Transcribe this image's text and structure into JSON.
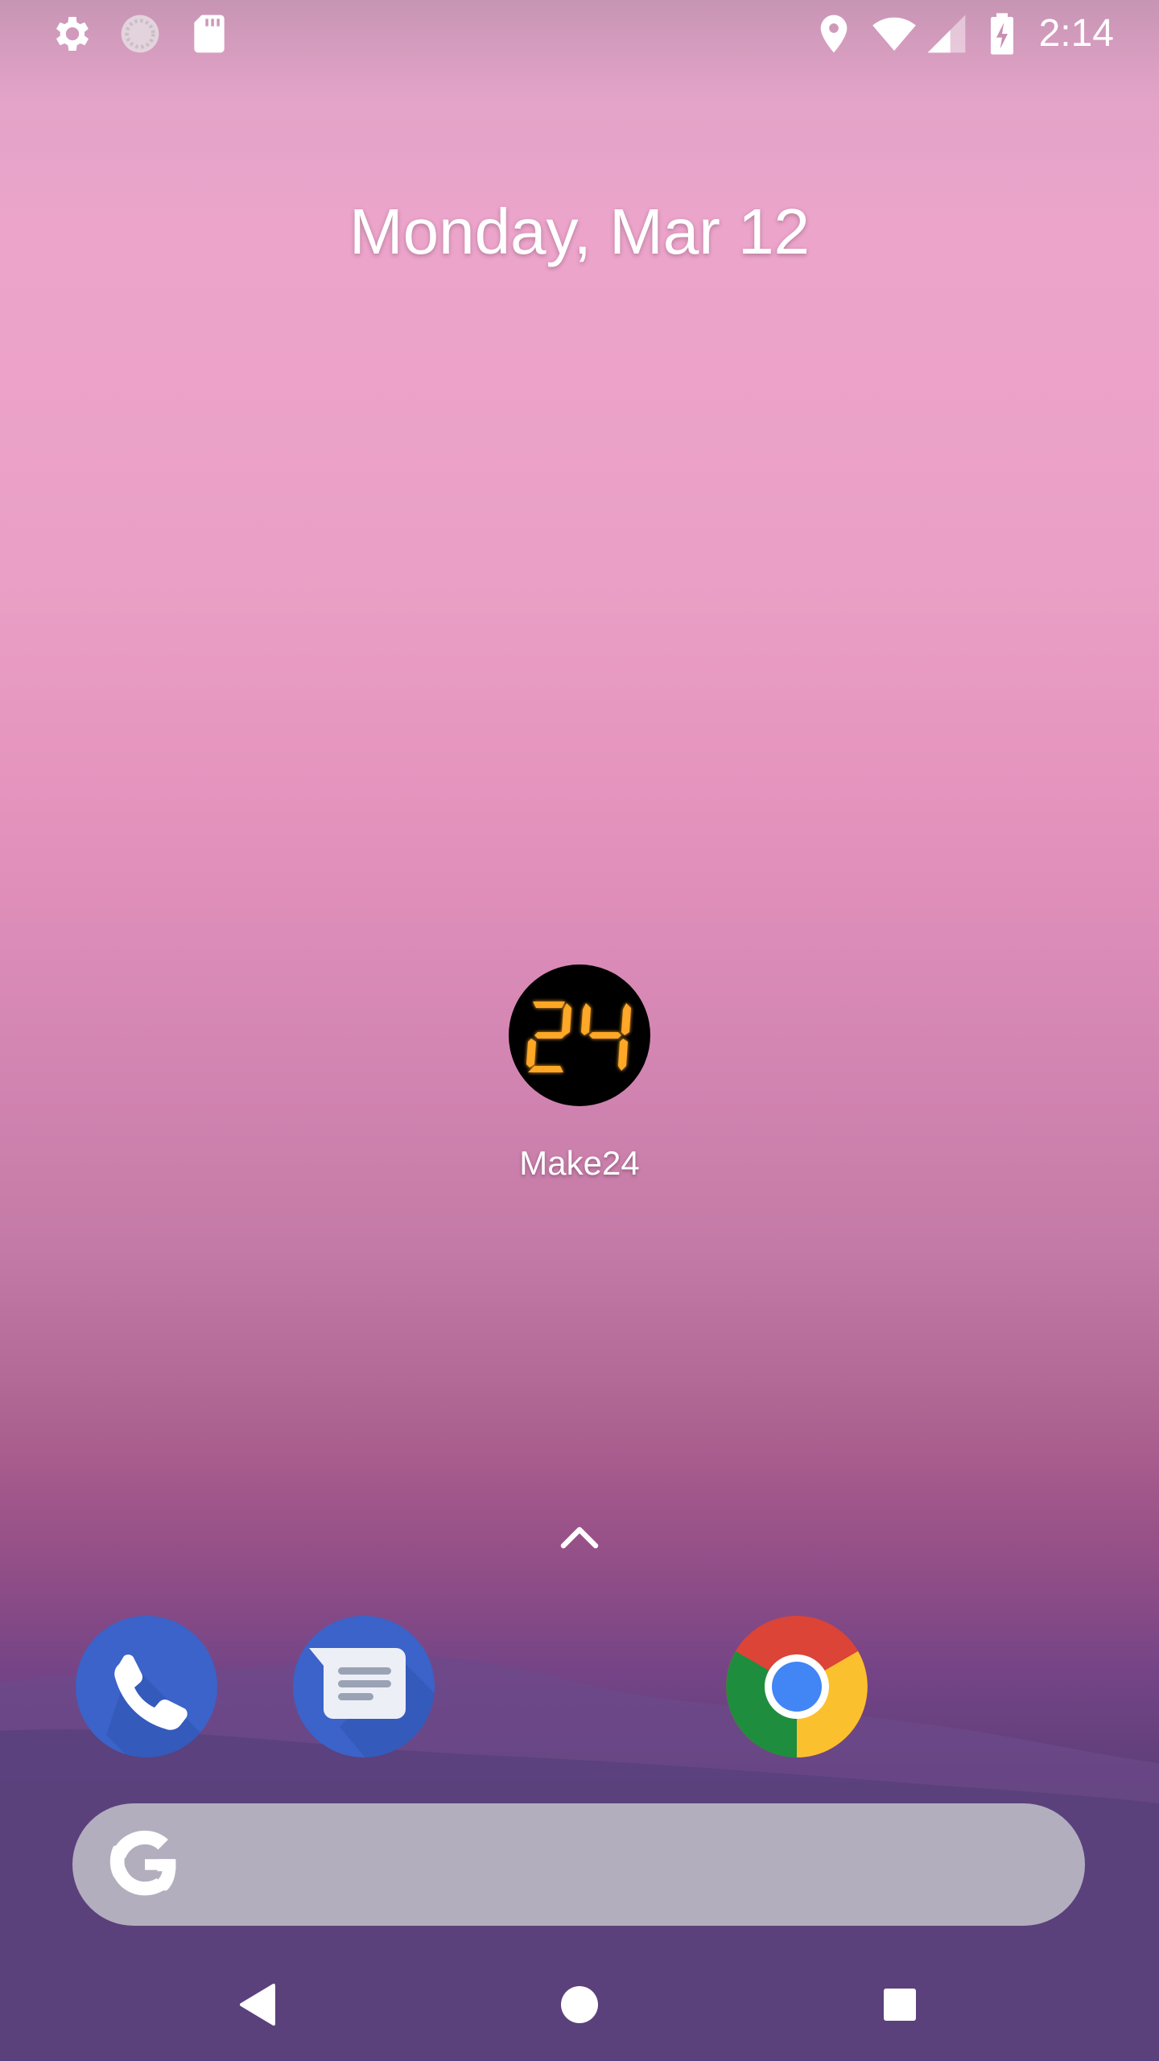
{
  "status_bar": {
    "time": "2:14",
    "left_icons": [
      "settings-icon",
      "sync-loading-icon",
      "sd-card-icon"
    ],
    "right_icons": [
      "location-icon",
      "wifi-icon",
      "cell-signal-icon",
      "battery-charging-icon"
    ]
  },
  "home": {
    "date": "Monday, Mar 12",
    "apps": [
      {
        "label": "Make24",
        "icon": "make24-icon",
        "icon_text": "24"
      }
    ]
  },
  "dock": {
    "apps": [
      "phone-icon",
      "messages-icon",
      "chrome-icon"
    ]
  },
  "search": {
    "icon": "google-g-icon",
    "placeholder": ""
  },
  "nav_bar": {
    "buttons": [
      "back-icon",
      "home-icon",
      "recents-icon"
    ]
  },
  "colors": {
    "dock_blue": "#3b63c9",
    "icon_digit_orange": "#ffa726",
    "search_bar": "#b3aebe"
  }
}
